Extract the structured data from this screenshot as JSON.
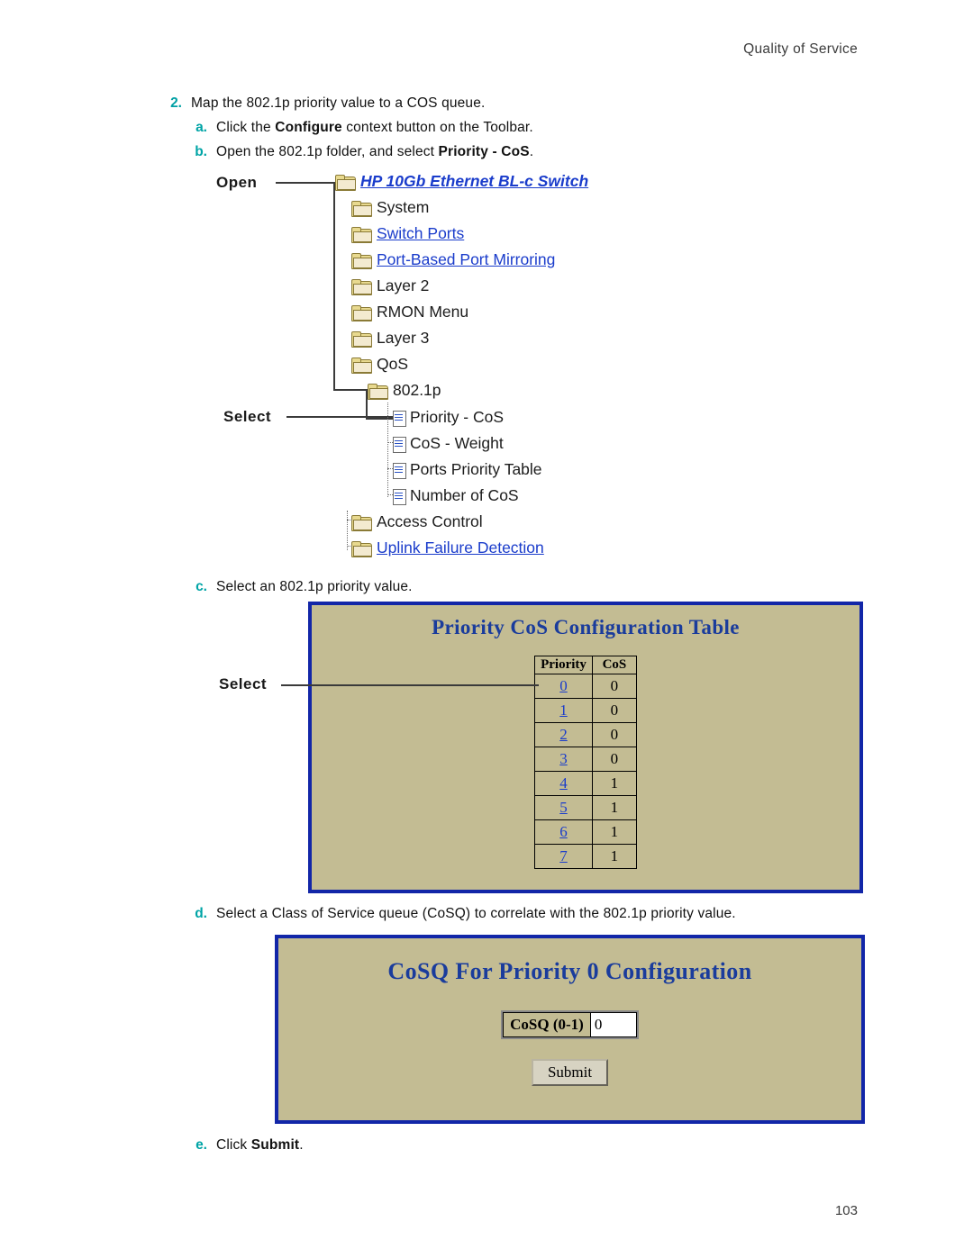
{
  "header": {
    "running_head": "Quality of Service",
    "page_number": "103"
  },
  "steps": {
    "s2": {
      "marker": "2.",
      "text": "Map the 802.1p priority value to a COS queue."
    },
    "a": {
      "marker": "a.",
      "pre": "Click the ",
      "bold": "Configure",
      "post": " context button on the Toolbar."
    },
    "b": {
      "marker": "b.",
      "pre": "Open the 802.1p folder, and select ",
      "bold": "Priority - CoS",
      "post": "."
    },
    "c": {
      "marker": "c.",
      "text": "Select an 802.1p priority value."
    },
    "d": {
      "marker": "d.",
      "text": "Select a Class of Service queue (CoSQ) to correlate with the 802.1p priority value."
    },
    "e": {
      "marker": "e.",
      "pre": "Click ",
      "bold": "Submit",
      "post": "."
    }
  },
  "tree": {
    "open_label": "Open",
    "select_label": "Select",
    "root": "HP 10Gb Ethernet BL-c Switch",
    "items": [
      {
        "label": "System",
        "kind": "folder",
        "link": false
      },
      {
        "label": "Switch Ports",
        "kind": "folder",
        "link": true
      },
      {
        "label": "Port-Based Port Mirroring",
        "kind": "folder",
        "link": true
      },
      {
        "label": "Layer 2",
        "kind": "folder",
        "link": false
      },
      {
        "label": "RMON Menu",
        "kind": "folder",
        "link": false
      },
      {
        "label": "Layer 3",
        "kind": "folder",
        "link": false
      },
      {
        "label": "QoS",
        "kind": "folder",
        "link": false
      },
      {
        "label": "802.1p",
        "kind": "folder",
        "link": false
      },
      {
        "label": "Priority - CoS",
        "kind": "doc",
        "link": false
      },
      {
        "label": "CoS - Weight",
        "kind": "doc",
        "link": false
      },
      {
        "label": "Ports Priority Table",
        "kind": "doc",
        "link": false
      },
      {
        "label": "Number of CoS",
        "kind": "doc",
        "link": false
      },
      {
        "label": "Access Control",
        "kind": "folder",
        "link": false
      },
      {
        "label": "Uplink Failure Detection",
        "kind": "folder",
        "link": true
      }
    ]
  },
  "priority_panel": {
    "title": "Priority CoS Configuration Table",
    "select_label": "Select",
    "columns": [
      "Priority",
      "CoS"
    ],
    "rows": [
      {
        "priority": "0",
        "cos": "0"
      },
      {
        "priority": "1",
        "cos": "0"
      },
      {
        "priority": "2",
        "cos": "0"
      },
      {
        "priority": "3",
        "cos": "0"
      },
      {
        "priority": "4",
        "cos": "1"
      },
      {
        "priority": "5",
        "cos": "1"
      },
      {
        "priority": "6",
        "cos": "1"
      },
      {
        "priority": "7",
        "cos": "1"
      }
    ]
  },
  "cosq_panel": {
    "title": "CoSQ For Priority 0 Configuration",
    "field_label": "CoSQ (0-1)",
    "field_value": "0",
    "submit_label": "Submit"
  }
}
